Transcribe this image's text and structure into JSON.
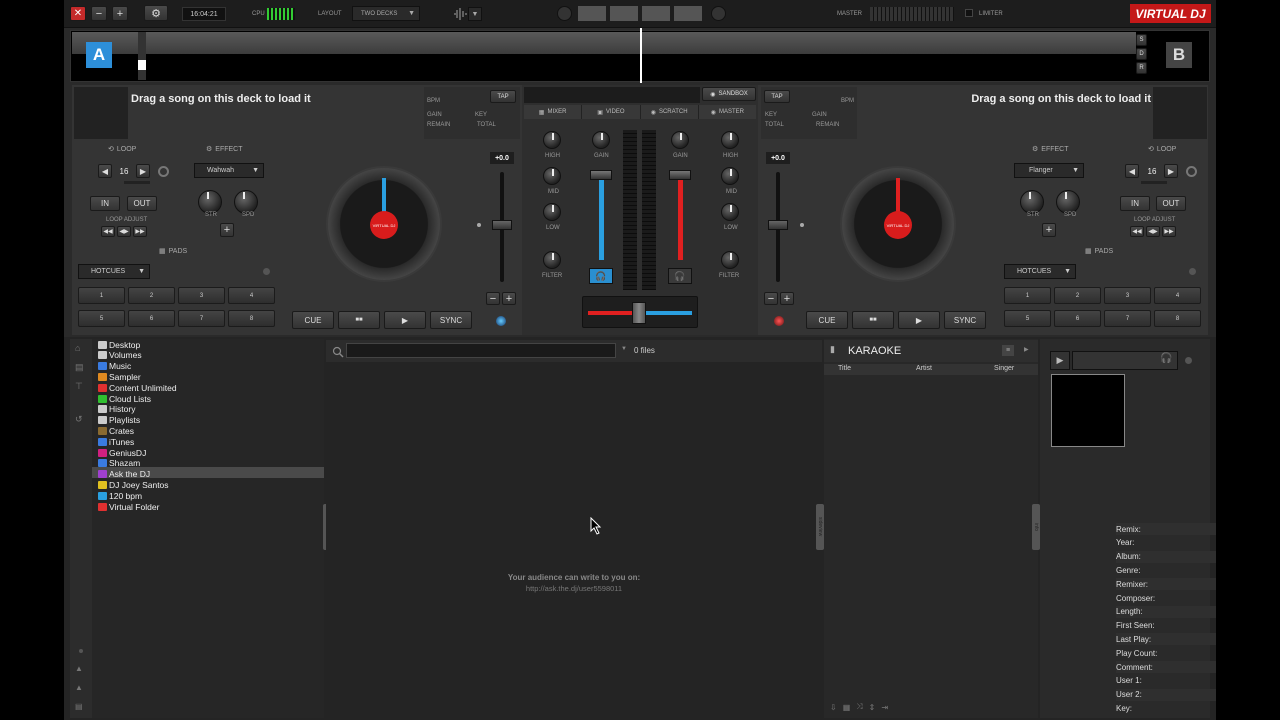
{
  "topbar": {
    "time": "16:04:21",
    "cpu_label": "CPU",
    "layout_label": "LAYOUT",
    "layout_value": "TWO DECKS",
    "master_label": "MASTER",
    "limiter_label": "LIMITER",
    "logo": "VIRTUAL DJ",
    "close_glyph": "✕",
    "minimize_glyph": "−",
    "maximize_glyph": "+",
    "settings_glyph": "⚙",
    "dropdown_glyph": "▼"
  },
  "waveform": {
    "deck_a_letter": "A",
    "deck_b_letter": "B",
    "side_buttons": [
      "S",
      "D",
      "R"
    ]
  },
  "deck_a": {
    "load_text": "Drag a song on this deck to load it",
    "info_labels": {
      "bpm": "BPM",
      "tap": "TAP",
      "gain": "GAIN",
      "key": "KEY",
      "remain": "REMAIN",
      "total": "TOTAL"
    },
    "loop_header": "LOOP",
    "loop_size": "16",
    "effect_header": "EFFECT",
    "effect_name": "Wahwah",
    "in": "IN",
    "out": "OUT",
    "loop_adjust": "LOOP ADJUST",
    "str": "STR",
    "spd": "SPD",
    "pads_header": "PADS",
    "pad_mode": "HOTCUES",
    "pads": [
      "1",
      "2",
      "3",
      "4",
      "5",
      "6",
      "7",
      "8"
    ],
    "pitch_value": "+0.0",
    "cue": "CUE",
    "play_pause": "■■",
    "play": "▶",
    "sync": "SYNC",
    "platter_label": "VIRTUAL DJ"
  },
  "deck_b": {
    "load_text": "Drag a song on this deck to load it",
    "info_labels": {
      "bpm": "BPM",
      "tap": "TAP",
      "gain": "GAIN",
      "key": "KEY",
      "remain": "REMAIN",
      "total": "TOTAL"
    },
    "loop_header": "LOOP",
    "loop_size": "16",
    "effect_header": "EFFECT",
    "effect_name": "Flanger",
    "in": "IN",
    "out": "OUT",
    "loop_adjust": "LOOP ADJUST",
    "str": "STR",
    "spd": "SPD",
    "pads_header": "PADS",
    "pad_mode": "HOTCUES",
    "pads": [
      "1",
      "2",
      "3",
      "4",
      "5",
      "6",
      "7",
      "8"
    ],
    "pitch_value": "+0.0",
    "cue": "CUE",
    "play_pause": "■■",
    "play": "▶",
    "sync": "SYNC",
    "platter_label": "VIRTUAL DJ"
  },
  "mixer": {
    "sandbox": "SANDBOX",
    "tabs": [
      "MIXER",
      "VIDEO",
      "SCRATCH",
      "MASTER"
    ],
    "high": "HIGH",
    "gain": "GAIN",
    "mid": "MID",
    "low": "LOW",
    "filter": "FILTER",
    "colors": {
      "deck_a": "#2a9fe0",
      "deck_b": "#e02020"
    }
  },
  "browser": {
    "folders": [
      {
        "label": "Desktop",
        "color": "#cccccc"
      },
      {
        "label": "Volumes",
        "color": "#cccccc"
      },
      {
        "label": "Music",
        "color": "#3a7be0"
      },
      {
        "label": "Sampler",
        "color": "#e08a20"
      },
      {
        "label": "Content Unlimited",
        "color": "#e03030"
      },
      {
        "label": "Cloud Lists",
        "color": "#30c030"
      },
      {
        "label": "History",
        "color": "#cccccc"
      },
      {
        "label": "Playlists",
        "color": "#cccccc"
      },
      {
        "label": "Crates",
        "color": "#8a6a30"
      },
      {
        "label": "iTunes",
        "color": "#3a7be0"
      },
      {
        "label": "GeniusDJ",
        "color": "#d02080"
      },
      {
        "label": "Shazam",
        "color": "#3a7be0"
      },
      {
        "label": "Ask the DJ",
        "color": "#a040d0"
      },
      {
        "label": "DJ Joey Santos",
        "color": "#e0c020"
      },
      {
        "label": "120 bpm",
        "color": "#2aa0e0"
      },
      {
        "label": "Virtual Folder",
        "color": "#e03030"
      }
    ],
    "selected_index": 12,
    "search_placeholder": "",
    "file_count": "0 files",
    "empty_line1": "Your audience can write to you on:",
    "empty_line2": "http://ask.the.dj/user5598011",
    "folders_tab": "folders",
    "sideview_tab": "sideview",
    "info_tab": "info"
  },
  "karaoke": {
    "title": "KARAOKE",
    "columns": [
      "Title",
      "Artist",
      "Singer"
    ]
  },
  "info_panel": {
    "fields": [
      "Remix:",
      "Year:",
      "Album:",
      "Genre:",
      "Remixer:",
      "Composer:",
      "Length:",
      "First Seen:",
      "Last Play:",
      "Play Count:",
      "Comment:",
      "User 1:",
      "User 2:",
      "Key:"
    ]
  }
}
